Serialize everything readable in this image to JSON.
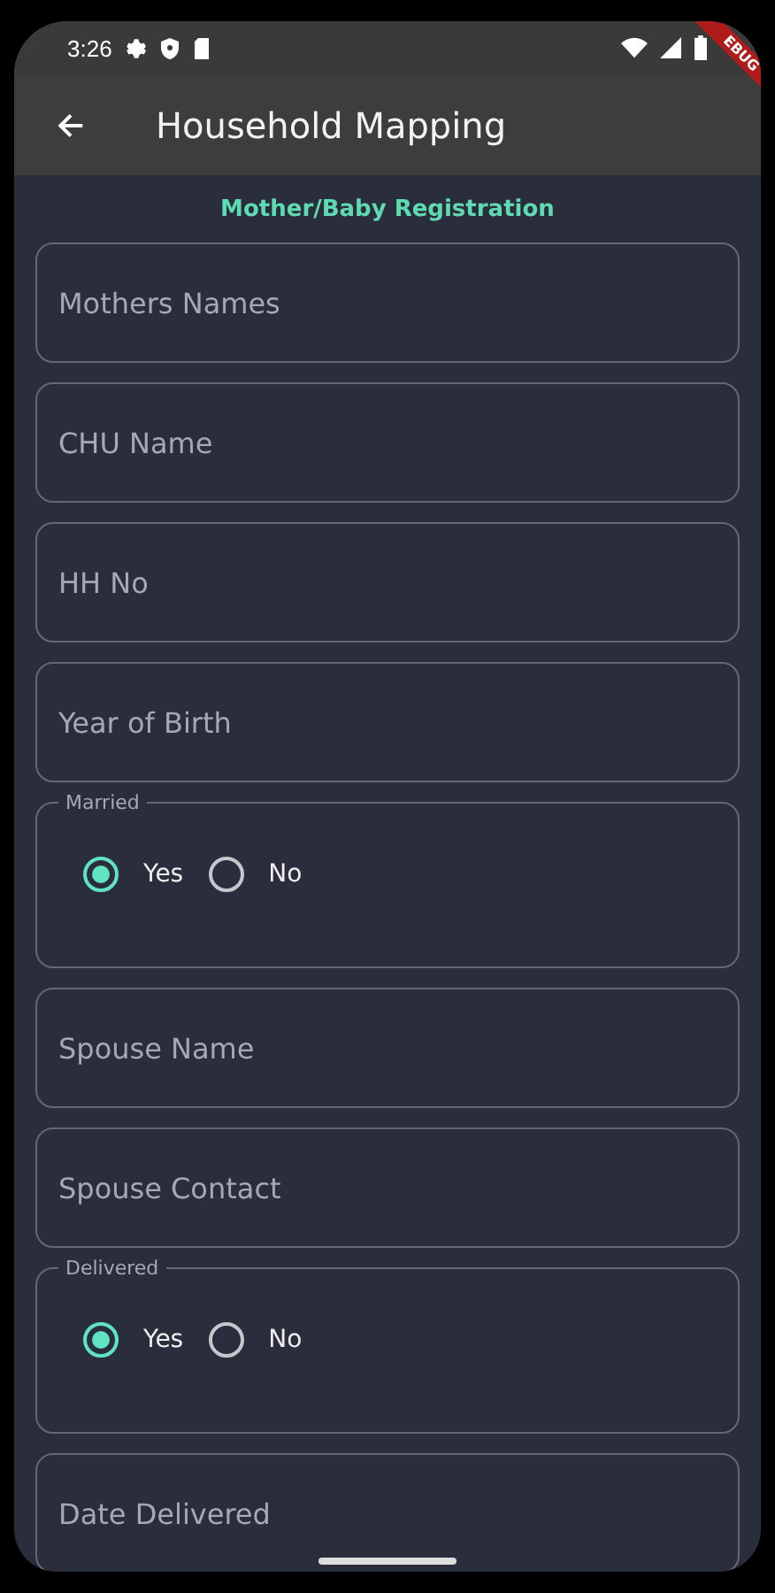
{
  "status_bar": {
    "time": "3:26"
  },
  "debug_banner": "EBUG",
  "app_bar": {
    "title": "Household Mapping"
  },
  "section_title": "Mother/Baby Registration",
  "form": [
    {
      "kind": "text",
      "placeholder": "Mothers Names"
    },
    {
      "kind": "text",
      "placeholder": "CHU Name"
    },
    {
      "kind": "text",
      "placeholder": "HH No"
    },
    {
      "kind": "text",
      "placeholder": "Year of Birth"
    },
    {
      "kind": "radio",
      "label": "Married",
      "options": [
        {
          "label": "Yes",
          "selected": true
        },
        {
          "label": "No",
          "selected": false
        }
      ]
    },
    {
      "kind": "text",
      "placeholder": "Spouse Name"
    },
    {
      "kind": "text",
      "placeholder": "Spouse Contact"
    },
    {
      "kind": "radio",
      "label": "Delivered",
      "options": [
        {
          "label": "Yes",
          "selected": true
        },
        {
          "label": "No",
          "selected": false
        }
      ]
    },
    {
      "kind": "text",
      "placeholder": "Date Delivered"
    }
  ]
}
